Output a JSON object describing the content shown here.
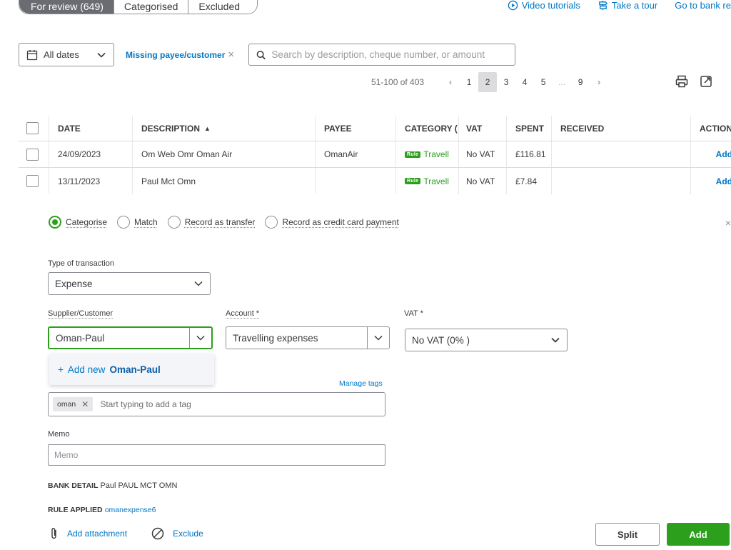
{
  "tabs": [
    "For review (649)",
    "Categorised",
    "Excluded"
  ],
  "top_links": {
    "video": "Video tutorials",
    "tour": "Take a tour",
    "bank": "Go to bank re"
  },
  "filters": {
    "dates": "All dates",
    "missing": "Missing payee/customer",
    "search_placeholder": "Search by description, cheque number, or amount"
  },
  "pager": {
    "range": "51-100 of 403",
    "prev": "‹",
    "pages": [
      "1",
      "2",
      "3",
      "4",
      "5",
      "...",
      "9"
    ],
    "active": "2",
    "next": "›"
  },
  "table": {
    "headers": {
      "date": "DATE",
      "description": "DESCRIPTION",
      "payee": "PAYEE",
      "category": "CATEGORY (",
      "vat": "VAT",
      "spent": "SPENT",
      "received": "RECEIVED",
      "action": "ACTION"
    },
    "sort_indicator": "▲",
    "rule_badge": "Rule",
    "rows": [
      {
        "date": "24/09/2023",
        "description": "Om Web Omr Oman Air",
        "payee": "OmanAir",
        "category": "Travell",
        "vat": "No VAT",
        "spent": "£116.81",
        "received": "",
        "action": "Add"
      },
      {
        "date": "13/11/2023",
        "description": "Paul Mct Omn",
        "payee": "",
        "category": "Travell",
        "vat": "No VAT",
        "spent": "£7.84",
        "received": "",
        "action": "Add"
      }
    ]
  },
  "panel": {
    "radios": [
      "Categorise",
      "Match",
      "Record as transfer",
      "Record as credit card payment"
    ],
    "close": "×",
    "type_label": "Type of transaction",
    "type_value": "Expense",
    "supplier_label": "Supplier/Customer",
    "supplier_value": "Oman-Paul",
    "account_label": "Account *",
    "account_value": "Travelling expenses",
    "vat_label": "VAT *",
    "vat_value": "No VAT (0% )",
    "dropdown": {
      "prefix": "+",
      "text": "Add new",
      "name": "Oman-Paul"
    },
    "manage_tags": "Manage tags",
    "tag_chip": "oman",
    "tag_placeholder": "Start typing to add a tag",
    "memo_label": "Memo",
    "memo_placeholder": "Memo",
    "bank_detail_label": "BANK DETAIL",
    "bank_detail_value": "Paul PAUL MCT OMN",
    "rule_applied_label": "RULE APPLIED",
    "rule_applied_value": "omanexpense6",
    "attachment": "Add attachment",
    "exclude": "Exclude",
    "split": "Split",
    "add": "Add"
  },
  "colors": {
    "accent_green": "#2ca01c",
    "link_blue": "#0077c5",
    "tab_active": "#6b6c72"
  }
}
